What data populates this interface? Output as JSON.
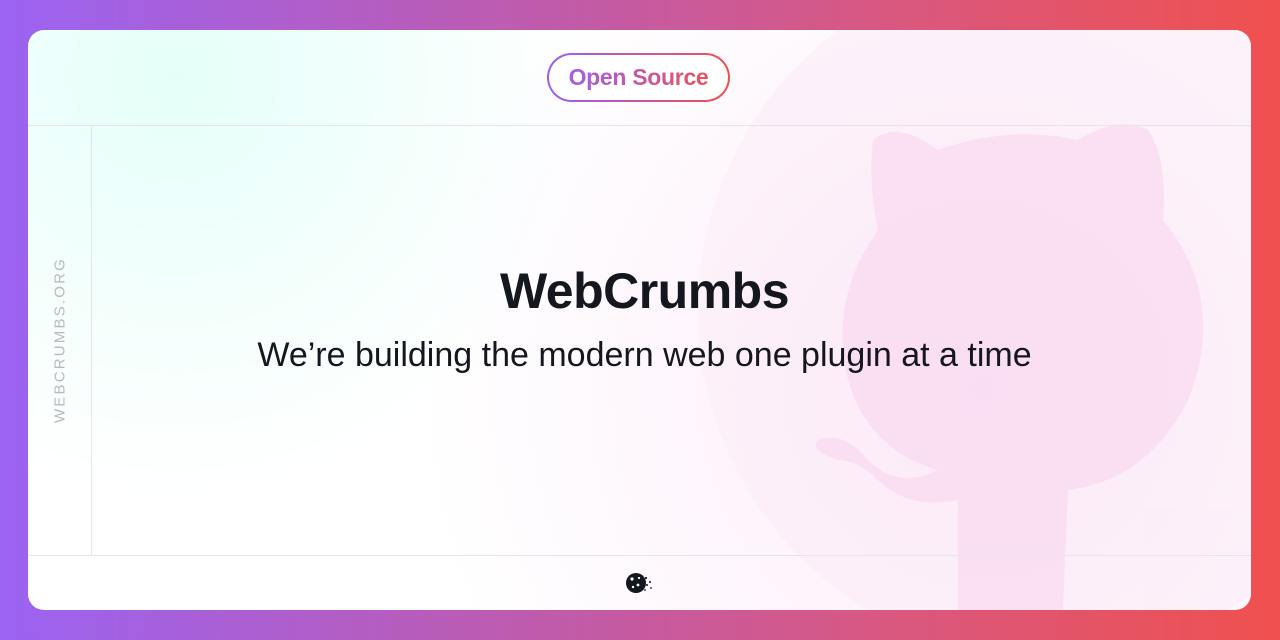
{
  "badge": {
    "label": "Open Source"
  },
  "sidebar": {
    "domain": "WEBCRUMBS.ORG"
  },
  "main": {
    "title": "WebCrumbs",
    "tagline": "We’re building the modern web one plugin at a time"
  },
  "footer": {
    "icon": "cookie-icon"
  },
  "background": {
    "watermark": "octocat-icon"
  },
  "colors": {
    "gradient_start": "#9b63f2",
    "gradient_end": "#f0504f",
    "text": "#15171f",
    "muted": "#b8b9c0"
  }
}
